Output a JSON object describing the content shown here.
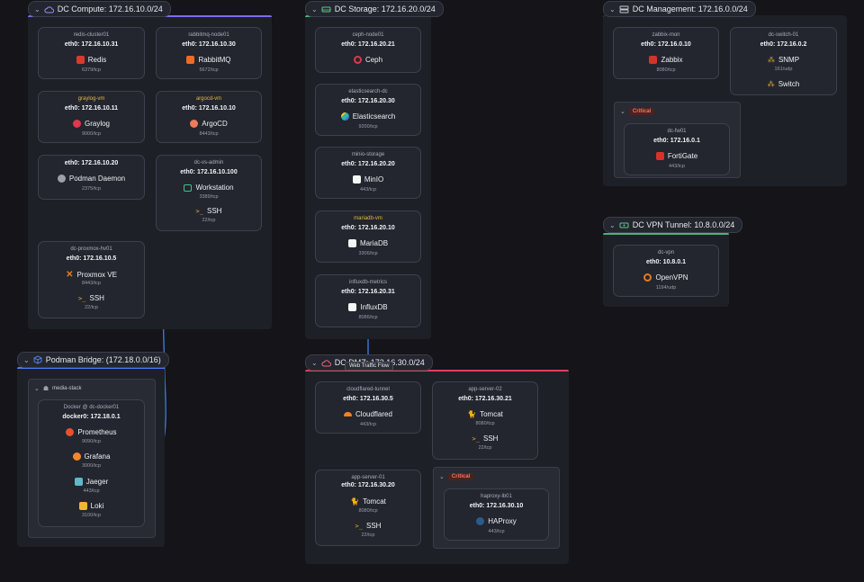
{
  "zones": {
    "compute": {
      "title": "DC Compute: 172.16.10.0/24",
      "accent": "#7c6cf0"
    },
    "storage": {
      "title": "DC Storage: 172.16.20.0/24",
      "accent": "#4fb07a"
    },
    "management": {
      "title": "DC Management: 172.16.0.0/24",
      "accent": "#3c414c"
    },
    "vpn": {
      "title": "DC VPN Tunnel: 10.8.0.0/24",
      "accent": "#4fb07a"
    },
    "podman": {
      "title": "Podman Bridge: (172.18.0.0/16)",
      "accent": "#4d7cf5"
    },
    "dmz": {
      "title": "DC DMZ: 172.16.30.0/24",
      "accent": "#e0405a"
    }
  },
  "link_tooltip": "Web Traffic Flow",
  "groups": {
    "media_stack": "media-stack",
    "critical_mgmt": "Critical",
    "critical_dmz": "Critical"
  },
  "nodes": {
    "redis": {
      "host": "redis-cluster01",
      "ip": "eth0: 172.16.10.31",
      "svc": "Redis",
      "port": "6379/tcp"
    },
    "rabbit": {
      "host": "rabbitmq-node01",
      "ip": "eth0: 172.16.10.30",
      "svc": "RabbitMQ",
      "port": "5672/tcp"
    },
    "graylog": {
      "host": "graylog-vm",
      "ip": "eth0: 172.16.10.11",
      "svc": "Graylog",
      "port": "9000/tcp"
    },
    "argocd": {
      "host": "argocd-vm",
      "ip": "eth0: 172.16.10.10",
      "svc": "ArgoCD",
      "port": "8443/tcp"
    },
    "podman": {
      "ip": "eth0: 172.16.10.20",
      "svc": "Podman Daemon",
      "port": "2375/tcp"
    },
    "vsadmin": {
      "host": "dc-vs-admin",
      "ip": "eth0: 172.16.10.100",
      "svc1": "Workstation",
      "port1": "3389/tcp",
      "svc2": "SSH",
      "port2": "22/tcp"
    },
    "proxmox": {
      "host": "dc-proxmox-hv01",
      "ip": "eth0: 172.16.10.5",
      "svc1": "Proxmox VE",
      "port1": "8443/tcp",
      "svc2": "SSH",
      "port2": "22/tcp"
    },
    "ceph": {
      "host": "ceph-node01",
      "ip": "eth0: 172.16.20.21",
      "svc": "Ceph"
    },
    "elastic": {
      "host": "elasticsearch-dc",
      "ip": "eth0: 172.16.20.30",
      "svc": "Elasticsearch",
      "port": "9200/tcp"
    },
    "minio": {
      "host": "minio-storage",
      "ip": "eth0: 172.16.20.20",
      "svc": "MinIO",
      "port": "443/tcp"
    },
    "mariadb": {
      "host": "mariadb-vm",
      "ip": "eth0: 172.16.20.10",
      "svc": "MariaDB",
      "port": "3306/tcp"
    },
    "influx": {
      "host": "influxdb-metrics",
      "ip": "eth0: 172.16.20.31",
      "svc": "InfluxDB",
      "port": "8086/tcp"
    },
    "zabbix": {
      "host": "zabbix-mon",
      "ip": "eth0: 172.16.0.10",
      "svc": "Zabbix",
      "port": "8080/tcp"
    },
    "switch": {
      "host": "dc-switch-01",
      "ip": "eth0: 172.16.0.2",
      "svc1": "SNMP",
      "port1": "161/udp",
      "svc2": "Switch"
    },
    "fw": {
      "host": "dc-fw01",
      "ip": "eth0: 172.16.0.1",
      "svc": "FortiGate",
      "port": "443/tcp"
    },
    "vpn": {
      "host": "dc-vpn",
      "ip": "eth0: 10.8.0.1",
      "svc": "OpenVPN",
      "port": "1194/udp"
    },
    "docker": {
      "host": "Docker @ dc-docker01",
      "ip": "docker0: 172.18.0.1",
      "svc1": "Prometheus",
      "port1": "9090/tcp",
      "svc2": "Grafana",
      "port2": "3000/tcp",
      "svc3": "Jaeger",
      "port3": "443/tcp",
      "svc4": "Loki",
      "port4": "3100/tcp"
    },
    "cloudflared": {
      "host": "cloudflared-tunnel",
      "ip": "eth0: 172.16.30.5",
      "svc": "Cloudflared",
      "port": "443/tcp"
    },
    "app2": {
      "host": "app-server-02",
      "ip": "eth0: 172.16.30.21",
      "svc1": "Tomcat",
      "port1": "8080/tcp",
      "svc2": "SSH",
      "port2": "22/tcp"
    },
    "app1": {
      "host": "app-server-01",
      "ip": "eth0: 172.16.30.20",
      "svc1": "Tomcat",
      "port1": "8080/tcp",
      "svc2": "SSH",
      "port2": "22/tcp"
    },
    "haproxy": {
      "host": "haproxy-lb01",
      "ip": "eth0: 172.16.30.10",
      "svc": "HAProxy",
      "port": "443/tcp"
    }
  }
}
